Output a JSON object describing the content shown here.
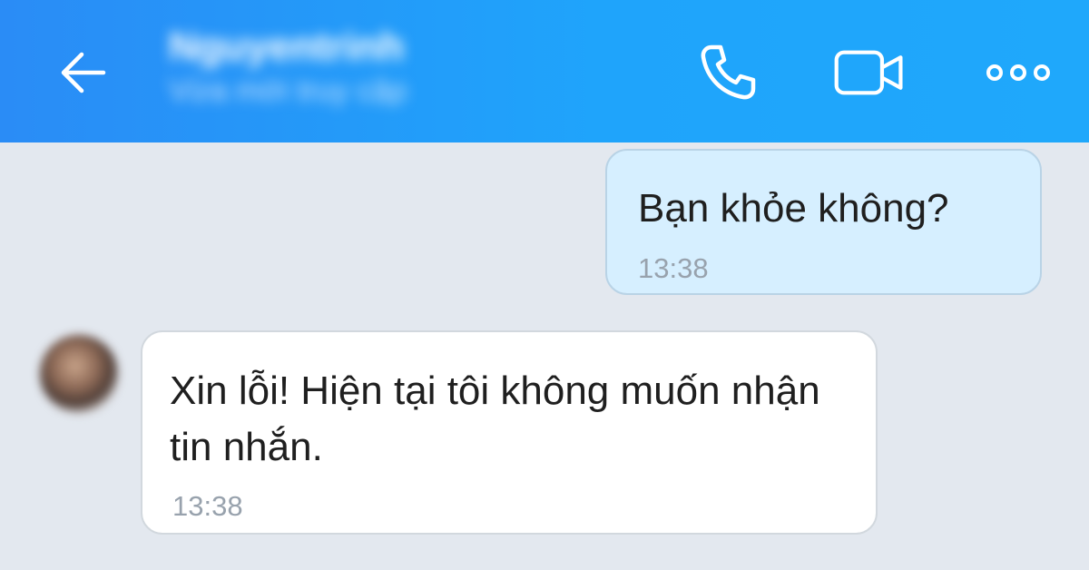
{
  "header": {
    "contact_name": "Nguyentrinh",
    "contact_status": "Vừa mới truy cập",
    "back_icon": "arrow-left-icon",
    "call_icon": "phone-icon",
    "video_icon": "video-camera-icon",
    "more_icon": "more-dots-icon"
  },
  "messages": [
    {
      "direction": "outgoing",
      "text": "Bạn khỏe không?",
      "time": "13:38"
    },
    {
      "direction": "incoming",
      "text": "Xin lỗi! Hiện tại tôi không muốn nhận tin nhắn.",
      "time": "13:38"
    }
  ],
  "colors": {
    "header_blue": "#1fa4fb",
    "chat_background": "#e3e8ef",
    "outgoing_bubble": "#d6efff",
    "incoming_bubble": "#ffffff"
  }
}
